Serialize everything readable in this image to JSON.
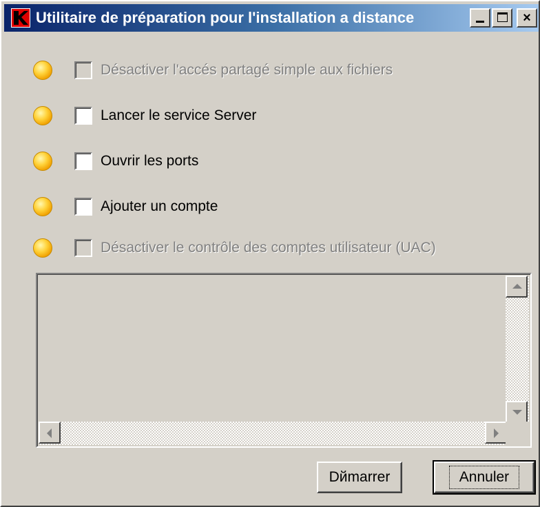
{
  "window": {
    "title": "Utilitaire de préparation pour l'installation a distance",
    "icon": "kaspersky-k-icon",
    "controls": {
      "minimize": "minimize-icon",
      "maximize": "maximize-icon",
      "close": "×"
    }
  },
  "tasks": [
    {
      "label": "Désactiver l'accés partagé simple aux fichiers",
      "checked": false,
      "enabled": false,
      "status": "pending-yellow"
    },
    {
      "label": "Lancer le service Server",
      "checked": false,
      "enabled": true,
      "status": "pending-yellow"
    },
    {
      "label": "Ouvrir les ports",
      "checked": false,
      "enabled": true,
      "status": "pending-yellow"
    },
    {
      "label": "Ajouter un compte",
      "checked": false,
      "enabled": true,
      "status": "pending-yellow"
    },
    {
      "label": "Désactiver le contrôle des comptes utilisateur (UAC)",
      "checked": false,
      "enabled": false,
      "status": "pending-yellow"
    }
  ],
  "log": {
    "text": ""
  },
  "buttons": {
    "start": "Dйmarrer",
    "cancel": "Annuler"
  },
  "colors": {
    "title_start": "#0a246a",
    "title_end": "#a6caf0",
    "face": "#d4d0c8",
    "status": "#ffd23a"
  }
}
